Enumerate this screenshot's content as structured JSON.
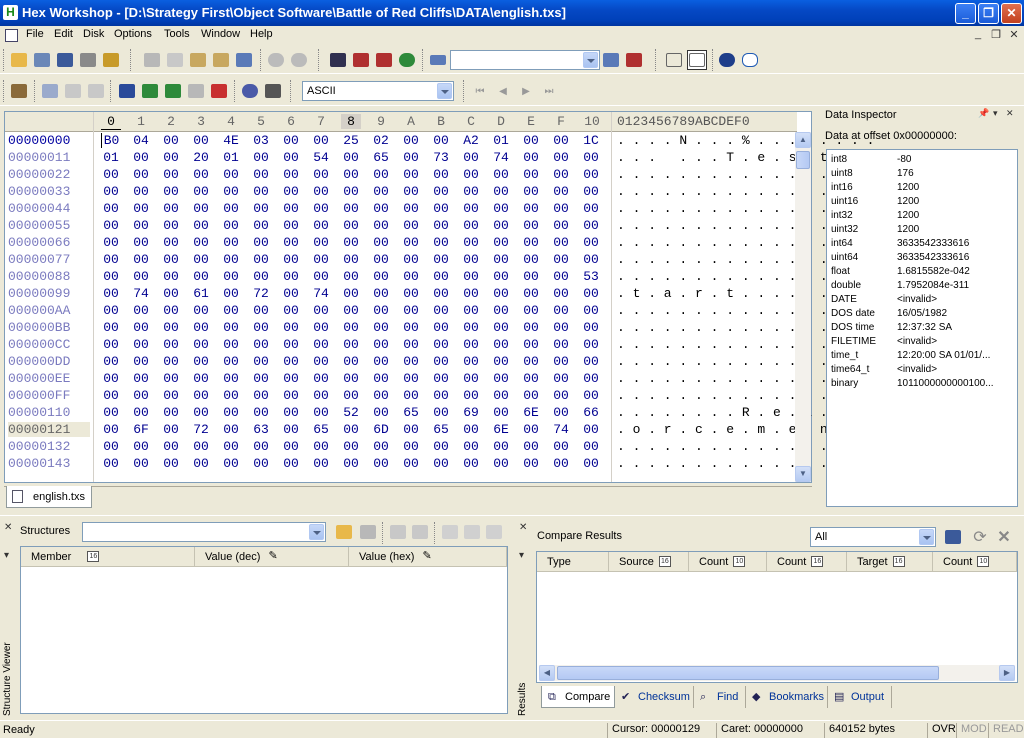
{
  "app": {
    "title": "Hex Workshop - [D:\\Strategy First\\Object Software\\Battle of Red Cliffs\\DATA\\english.txs]",
    "icon_letter": "H"
  },
  "window_controls": {
    "minimize": "_",
    "restore": "❐",
    "close": "✕"
  },
  "menu": [
    "File",
    "Edit",
    "Disk",
    "Options",
    "Tools",
    "Window",
    "Help"
  ],
  "toolbar": {
    "encoding_select": "ASCII",
    "search_input": ""
  },
  "hex": {
    "header_cols": [
      "0",
      "1",
      "2",
      "3",
      "4",
      "5",
      "6",
      "7",
      "8",
      "9",
      "A",
      "B",
      "C",
      "D",
      "E",
      "F",
      "10"
    ],
    "ascii_header": "0123456789ABCDEF0",
    "rows": [
      {
        "offset": "00000000",
        "bytes": [
          "B0",
          "04",
          "00",
          "00",
          "4E",
          "03",
          "00",
          "00",
          "25",
          "02",
          "00",
          "00",
          "A2",
          "01",
          "00",
          "00",
          "1C"
        ],
        "ascii": ". . . . N . . . % . . . . . . . ."
      },
      {
        "offset": "00000011",
        "bytes": [
          "01",
          "00",
          "00",
          "20",
          "01",
          "00",
          "00",
          "54",
          "00",
          "65",
          "00",
          "73",
          "00",
          "74",
          "00",
          "00",
          "00"
        ],
        "ascii": ". . .   . . . T . e . s . t . . ."
      },
      {
        "offset": "00000022",
        "bytes": [
          "00",
          "00",
          "00",
          "00",
          "00",
          "00",
          "00",
          "00",
          "00",
          "00",
          "00",
          "00",
          "00",
          "00",
          "00",
          "00",
          "00"
        ],
        "ascii": ". . . . . . . . . . . . . . . . ."
      },
      {
        "offset": "00000033",
        "bytes": [
          "00",
          "00",
          "00",
          "00",
          "00",
          "00",
          "00",
          "00",
          "00",
          "00",
          "00",
          "00",
          "00",
          "00",
          "00",
          "00",
          "00"
        ],
        "ascii": ". . . . . . . . . . . . . . . . ."
      },
      {
        "offset": "00000044",
        "bytes": [
          "00",
          "00",
          "00",
          "00",
          "00",
          "00",
          "00",
          "00",
          "00",
          "00",
          "00",
          "00",
          "00",
          "00",
          "00",
          "00",
          "00"
        ],
        "ascii": ". . . . . . . . . . . . . . . . ."
      },
      {
        "offset": "00000055",
        "bytes": [
          "00",
          "00",
          "00",
          "00",
          "00",
          "00",
          "00",
          "00",
          "00",
          "00",
          "00",
          "00",
          "00",
          "00",
          "00",
          "00",
          "00"
        ],
        "ascii": ". . . . . . . . . . . . . . . . ."
      },
      {
        "offset": "00000066",
        "bytes": [
          "00",
          "00",
          "00",
          "00",
          "00",
          "00",
          "00",
          "00",
          "00",
          "00",
          "00",
          "00",
          "00",
          "00",
          "00",
          "00",
          "00"
        ],
        "ascii": ". . . . . . . . . . . . . . . . ."
      },
      {
        "offset": "00000077",
        "bytes": [
          "00",
          "00",
          "00",
          "00",
          "00",
          "00",
          "00",
          "00",
          "00",
          "00",
          "00",
          "00",
          "00",
          "00",
          "00",
          "00",
          "00"
        ],
        "ascii": ". . . . . . . . . . . . . . . . ."
      },
      {
        "offset": "00000088",
        "bytes": [
          "00",
          "00",
          "00",
          "00",
          "00",
          "00",
          "00",
          "00",
          "00",
          "00",
          "00",
          "00",
          "00",
          "00",
          "00",
          "00",
          "53"
        ],
        "ascii": ". . . . . . . . . . . . . . . . S"
      },
      {
        "offset": "00000099",
        "bytes": [
          "00",
          "74",
          "00",
          "61",
          "00",
          "72",
          "00",
          "74",
          "00",
          "00",
          "00",
          "00",
          "00",
          "00",
          "00",
          "00",
          "00"
        ],
        "ascii": ". t . a . r . t . . . . . . . . ."
      },
      {
        "offset": "000000AA",
        "bytes": [
          "00",
          "00",
          "00",
          "00",
          "00",
          "00",
          "00",
          "00",
          "00",
          "00",
          "00",
          "00",
          "00",
          "00",
          "00",
          "00",
          "00"
        ],
        "ascii": ". . . . . . . . . . . . . . . . ."
      },
      {
        "offset": "000000BB",
        "bytes": [
          "00",
          "00",
          "00",
          "00",
          "00",
          "00",
          "00",
          "00",
          "00",
          "00",
          "00",
          "00",
          "00",
          "00",
          "00",
          "00",
          "00"
        ],
        "ascii": ". . . . . . . . . . . . . . . . ."
      },
      {
        "offset": "000000CC",
        "bytes": [
          "00",
          "00",
          "00",
          "00",
          "00",
          "00",
          "00",
          "00",
          "00",
          "00",
          "00",
          "00",
          "00",
          "00",
          "00",
          "00",
          "00"
        ],
        "ascii": ". . . . . . . . . . . . . . . . ."
      },
      {
        "offset": "000000DD",
        "bytes": [
          "00",
          "00",
          "00",
          "00",
          "00",
          "00",
          "00",
          "00",
          "00",
          "00",
          "00",
          "00",
          "00",
          "00",
          "00",
          "00",
          "00"
        ],
        "ascii": ". . . . . . . . . . . . . . . . ."
      },
      {
        "offset": "000000EE",
        "bytes": [
          "00",
          "00",
          "00",
          "00",
          "00",
          "00",
          "00",
          "00",
          "00",
          "00",
          "00",
          "00",
          "00",
          "00",
          "00",
          "00",
          "00"
        ],
        "ascii": ". . . . . . . . . . . . . . . . ."
      },
      {
        "offset": "000000FF",
        "bytes": [
          "00",
          "00",
          "00",
          "00",
          "00",
          "00",
          "00",
          "00",
          "00",
          "00",
          "00",
          "00",
          "00",
          "00",
          "00",
          "00",
          "00"
        ],
        "ascii": ". . . . . . . . . . . . . . . . ."
      },
      {
        "offset": "00000110",
        "bytes": [
          "00",
          "00",
          "00",
          "00",
          "00",
          "00",
          "00",
          "00",
          "52",
          "00",
          "65",
          "00",
          "69",
          "00",
          "6E",
          "00",
          "66"
        ],
        "ascii": ". . . . . . . . R . e . i . n . f"
      },
      {
        "offset": "00000121",
        "bytes": [
          "00",
          "6F",
          "00",
          "72",
          "00",
          "63",
          "00",
          "65",
          "00",
          "6D",
          "00",
          "65",
          "00",
          "6E",
          "00",
          "74",
          "00"
        ],
        "ascii": ". o . r . c . e . m . e . n . t ."
      },
      {
        "offset": "00000132",
        "bytes": [
          "00",
          "00",
          "00",
          "00",
          "00",
          "00",
          "00",
          "00",
          "00",
          "00",
          "00",
          "00",
          "00",
          "00",
          "00",
          "00",
          "00"
        ],
        "ascii": ". . . . . . . . . . . . . . . . ."
      },
      {
        "offset": "00000143",
        "bytes": [
          "00",
          "00",
          "00",
          "00",
          "00",
          "00",
          "00",
          "00",
          "00",
          "00",
          "00",
          "00",
          "00",
          "00",
          "00",
          "00",
          "00"
        ],
        "ascii": ". . . . . . . . . . . . . . . . ."
      }
    ]
  },
  "file_tab": "english.txs",
  "data_inspector": {
    "title": "Data Inspector",
    "offset_label": "Data at offset 0x00000000:",
    "items": [
      {
        "k": "int8",
        "v": "-80"
      },
      {
        "k": "uint8",
        "v": "176"
      },
      {
        "k": "int16",
        "v": "1200"
      },
      {
        "k": "uint16",
        "v": "1200"
      },
      {
        "k": "int32",
        "v": "1200"
      },
      {
        "k": "uint32",
        "v": "1200"
      },
      {
        "k": "int64",
        "v": "3633542333616"
      },
      {
        "k": "uint64",
        "v": "3633542333616"
      },
      {
        "k": "float",
        "v": "1.6815582e-042"
      },
      {
        "k": "double",
        "v": "1.7952084e-311"
      },
      {
        "k": "DATE",
        "v": "<invalid>"
      },
      {
        "k": "DOS date",
        "v": "16/05/1982"
      },
      {
        "k": "DOS time",
        "v": "12:37:32 SA"
      },
      {
        "k": "FILETIME",
        "v": "<invalid>"
      },
      {
        "k": "time_t",
        "v": "12:20:00 SA 01/01/..."
      },
      {
        "k": "time64_t",
        "v": "<invalid>"
      },
      {
        "k": "binary",
        "v": "1011000000000100..."
      }
    ]
  },
  "structures": {
    "label": "Structures",
    "side_title": "Structure Viewer",
    "columns": [
      "Member",
      "Value (dec)",
      "Value (hex)"
    ]
  },
  "compare": {
    "title": "Compare Results",
    "filter": "All",
    "side_title": "Results",
    "columns": [
      "Type",
      "Source",
      "Count",
      "Count",
      "Target",
      "Count"
    ],
    "tabs": [
      "Compare",
      "Checksum",
      "Find",
      "Bookmarks",
      "Output"
    ]
  },
  "status": {
    "ready": "Ready",
    "cursor": "Cursor: 00000129",
    "caret": "Caret: 00000000",
    "size": "640152 bytes",
    "ovr": "OVR",
    "mod": "MOD",
    "read": "READ"
  },
  "colors": {
    "title_bar": "#0548C4",
    "offset_text": "#0000A0",
    "hex_text": "#000090"
  }
}
